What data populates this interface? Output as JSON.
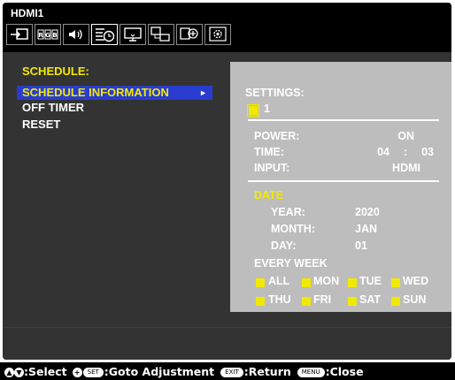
{
  "osd": {
    "source": "HDMI1",
    "menu_icons": [
      {
        "name": "input-icon"
      },
      {
        "name": "picture-icon"
      },
      {
        "name": "audio-icon"
      },
      {
        "name": "schedule-icon",
        "active": true
      },
      {
        "name": "display-icon"
      },
      {
        "name": "multi-input-icon"
      },
      {
        "name": "protect-icon"
      },
      {
        "name": "advanced-icon"
      }
    ]
  },
  "menu": {
    "title": "SCHEDULE:",
    "items": [
      {
        "label": "SCHEDULE INFORMATION",
        "selected": true,
        "arrow": "►"
      },
      {
        "label": "OFF TIMER"
      },
      {
        "label": "RESET"
      }
    ]
  },
  "panel": {
    "settings_label": "SETTINGS:",
    "settings_number": "1",
    "power_label": "POWER:",
    "power_value": "ON",
    "time_label": "TIME:",
    "time_hour": "04",
    "time_sep": ":",
    "time_min": "03",
    "input_label": "INPUT:",
    "input_value": "HDMI",
    "date_label": "DATE",
    "year_label": "YEAR:",
    "year_value": "2020",
    "month_label": "MONTH:",
    "month_value": "JAN",
    "day_label": "DAY:",
    "day_value": "01",
    "every_week_label": "EVERY WEEK",
    "days": [
      "ALL",
      "MON",
      "TUE",
      "WED",
      "THU",
      "FRI",
      "SAT",
      "SUN"
    ]
  },
  "footer": {
    "select_label": ":Select",
    "set_key": "SET",
    "goto_label": ":Goto Adjustment",
    "exit_key": "EXIT",
    "return_label": ":Return",
    "menu_key": "MENU",
    "close_label": ":Close"
  },
  "colors": {
    "highlight": "#f2e900",
    "selection_bar": "#2a3cd0",
    "panel_bg": "#bdbdbd",
    "osd_bg": "#333333"
  }
}
